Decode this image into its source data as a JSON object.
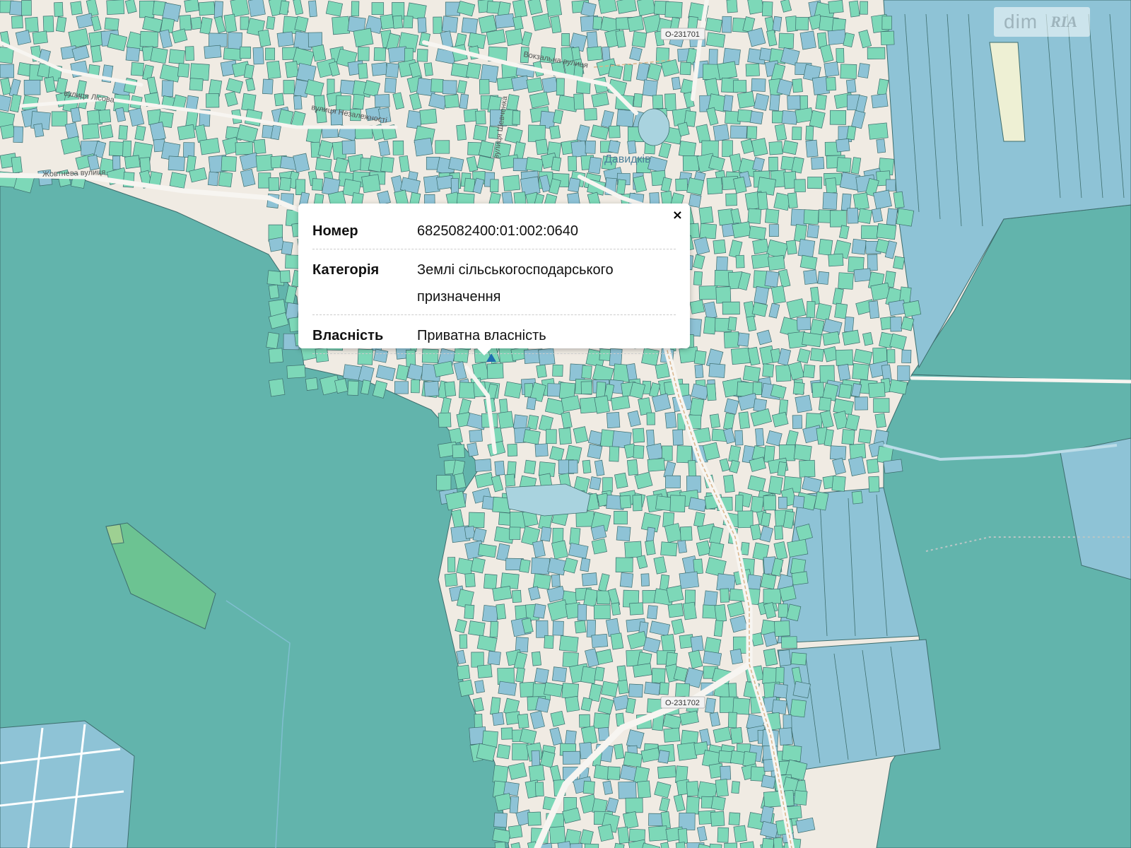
{
  "map": {
    "place_label": "Давидків",
    "road_labels": [
      "Жовтнева вулиця",
      "вулиця Лісова",
      "вулиця Незалежності",
      "Вокзальна вулиця",
      "вулиця Шевченка"
    ],
    "shields": [
      "О-231701",
      "О-231702"
    ],
    "colors": {
      "forest": "#62b4ac",
      "residential": "#7dd8b8",
      "agricultural": "#8ec3d6",
      "meadow": "#6cc392",
      "background": "#f0ebe3",
      "water": "#a9d3df",
      "parcel_outline": "#3d6d6d"
    }
  },
  "watermark": {
    "brand_left": "dim",
    "brand_right": "RIA"
  },
  "popup": {
    "close_label": "×",
    "rows": [
      {
        "key": "Номер",
        "value": "6825082400:01:002:0640"
      },
      {
        "key": "Категорія",
        "value": "Землі сільськогосподарського призначення"
      },
      {
        "key": "Власність",
        "value": "Приватна власність"
      }
    ]
  },
  "marker_icon": "parcel-marker-icon"
}
